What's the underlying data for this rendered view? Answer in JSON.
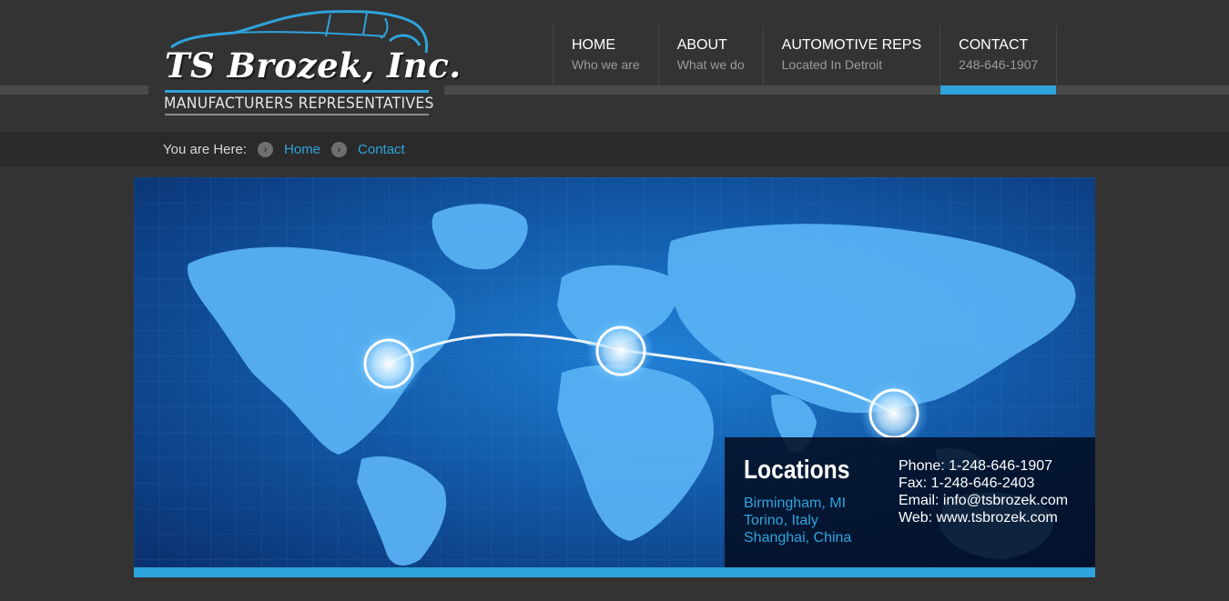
{
  "logo": {
    "name": "TS Brozek, Inc.",
    "tagline": "MANUFACTURERS REPRESENTATIVES"
  },
  "nav": [
    {
      "title": "HOME",
      "sub": "Who we are",
      "active": false
    },
    {
      "title": "ABOUT",
      "sub": "What we do",
      "active": false
    },
    {
      "title": "AUTOMOTIVE REPS",
      "sub": "Located In Detroit",
      "active": false
    },
    {
      "title": "CONTACT",
      "sub": "248-646-1907",
      "active": true
    }
  ],
  "breadcrumb": {
    "label": "You are Here:",
    "items": [
      "Home",
      "Contact"
    ]
  },
  "locations": {
    "heading": "Locations",
    "cities": [
      "Birmingham, MI",
      "Torino, Italy",
      "Shanghai, China"
    ],
    "phone": "Phone: 1-248-646-1907",
    "fax": "Fax: 1-248-646-2403",
    "email": "Email: info@tsbrozek.com",
    "web": "Web: www.tsbrozek.com"
  },
  "colors": {
    "accent": "#2fa3dc",
    "background": "#333333"
  },
  "icons": [
    "car-outline-icon",
    "chevron-right-icon",
    "world-map-image"
  ]
}
